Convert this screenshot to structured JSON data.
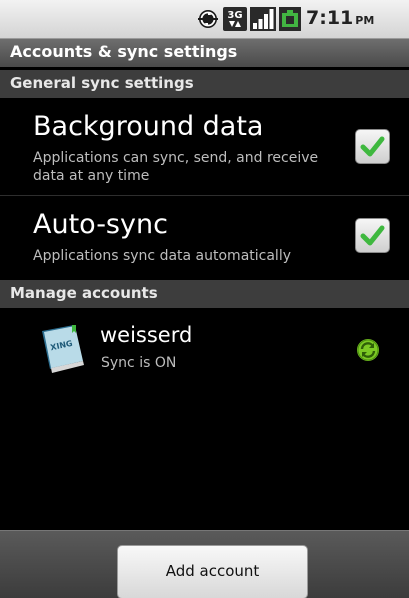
{
  "status_bar": {
    "time": "7:11",
    "ampm": "PM",
    "network_badge": "3G",
    "icons": [
      "sync-icon",
      "3g-icon",
      "signal-icon",
      "battery-icon"
    ]
  },
  "title_bar": {
    "title": "Accounts & sync settings"
  },
  "general_section": {
    "header": "General sync settings",
    "items": [
      {
        "title": "Background data",
        "summary": "Applications can sync, send, and receive data at any time",
        "checked": true
      },
      {
        "title": "Auto-sync",
        "summary": "Applications sync data automatically",
        "checked": true
      }
    ]
  },
  "manage_section": {
    "header": "Manage accounts",
    "accounts": [
      {
        "name": "weisserd",
        "status": "Sync is ON",
        "icon": "xing-book-icon",
        "icon_text": "XING"
      }
    ]
  },
  "bottom_bar": {
    "add_account_label": "Add account"
  },
  "colors": {
    "background": "#000000",
    "check_green": "#3fb83f",
    "sync_green": "#7cc924",
    "section_header": "#3d3d3d"
  }
}
